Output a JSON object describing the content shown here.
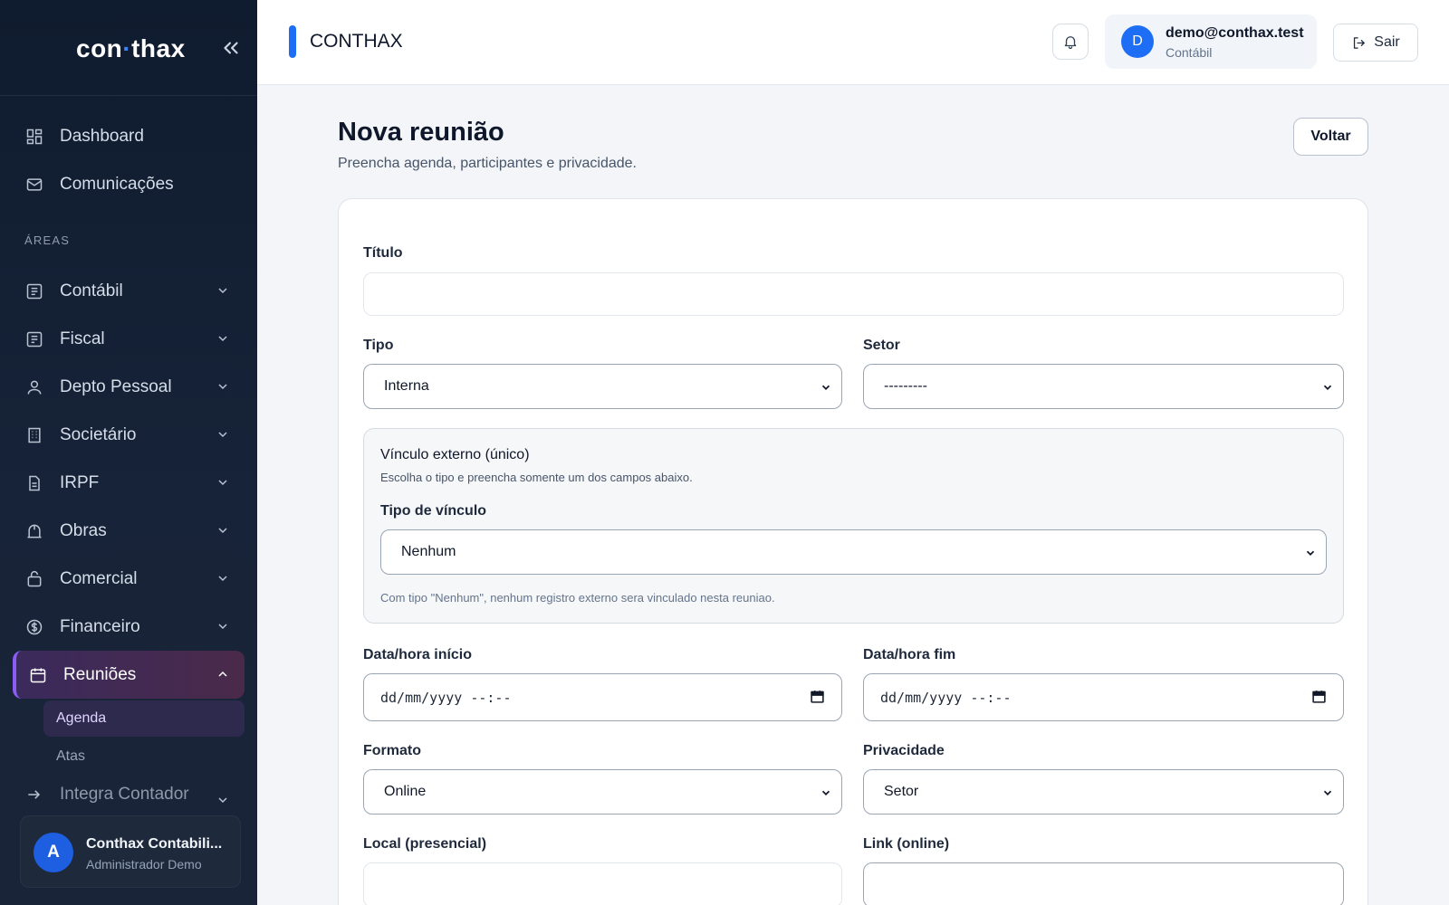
{
  "sidebar": {
    "logo_left": "con",
    "logo_dot": "·",
    "logo_right": "thax",
    "items": [
      {
        "label": "Dashboard",
        "icon": "dashboard-icon"
      },
      {
        "label": "Comunicações",
        "icon": "mail-icon"
      }
    ],
    "section_label": "ÁREAS",
    "areas": [
      {
        "label": "Contábil",
        "icon": "ledger-icon"
      },
      {
        "label": "Fiscal",
        "icon": "receipt-icon"
      },
      {
        "label": "Depto Pessoal",
        "icon": "person-icon"
      },
      {
        "label": "Societário",
        "icon": "building-icon"
      },
      {
        "label": "IRPF",
        "icon": "document-icon"
      },
      {
        "label": "Obras",
        "icon": "construction-icon"
      },
      {
        "label": "Comercial",
        "icon": "bag-icon"
      },
      {
        "label": "Financeiro",
        "icon": "dollar-icon"
      }
    ],
    "active_item": {
      "label": "Reuniões",
      "icon": "calendar-icon"
    },
    "sub_items": [
      "Agenda",
      "Atas"
    ],
    "partial_item": "Integra Contador",
    "user": {
      "avatar_letter": "A",
      "name": "Conthax Contabili...",
      "role": "Administrador Demo"
    }
  },
  "topbar": {
    "title": "CONTHAX",
    "account": {
      "avatar_letter": "D",
      "email": "demo@conthax.test",
      "role": "Contábil"
    },
    "logout_label": "Sair"
  },
  "main": {
    "title": "Nova reunião",
    "subtitle": "Preencha agenda, participantes e privacidade.",
    "back_label": "Voltar"
  },
  "form": {
    "titulo_label": "Título",
    "titulo_value": "",
    "tipo_label": "Tipo",
    "tipo_value": "Interna",
    "setor_label": "Setor",
    "setor_value": "---------",
    "vinculo": {
      "title": "Vínculo externo (único)",
      "description": "Escolha o tipo e preencha somente um dos campos abaixo.",
      "tipo_label": "Tipo de vínculo",
      "tipo_value": "Nenhum",
      "note": "Com tipo \"Nenhum\", nenhum registro externo sera vinculado nesta reuniao."
    },
    "inicio_label": "Data/hora início",
    "inicio_placeholder": "dd/mm/yyyy --:--",
    "fim_label": "Data/hora fim",
    "fim_placeholder": "dd/mm/yyyy --:--",
    "formato_label": "Formato",
    "formato_value": "Online",
    "privacidade_label": "Privacidade",
    "privacidade_value": "Setor",
    "local_label": "Local (presencial)",
    "link_label": "Link (online)"
  },
  "colors": {
    "sidebar_bg": "#0f1b2e",
    "accent": "#1d6ef5",
    "active_border": "#8b5cf6",
    "active_bg": "#3b2a5c"
  }
}
